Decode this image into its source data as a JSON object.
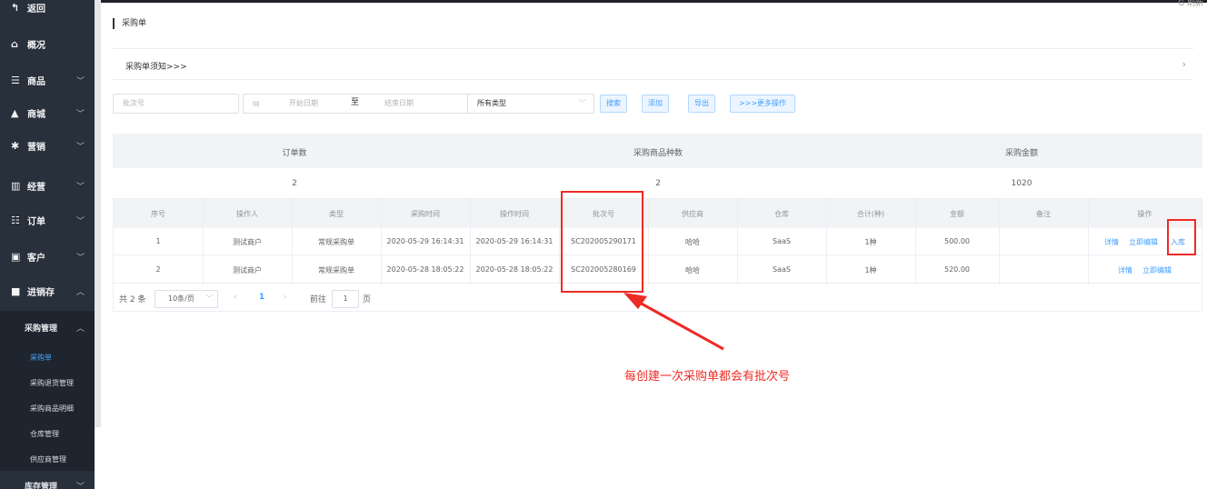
{
  "topbar": {
    "corner_text": "G 刷新"
  },
  "sidebar": {
    "items": [
      {
        "icon": "back-arrow-icon",
        "glyph": "↰",
        "label": "返回",
        "chevron": ""
      },
      {
        "icon": "home-icon",
        "glyph": "⌂",
        "label": "概况",
        "chevron": ""
      },
      {
        "icon": "list-icon",
        "glyph": "☰",
        "label": "商品",
        "chevron": "﹀"
      },
      {
        "icon": "shopping-bag-icon",
        "glyph": "▲",
        "label": "商城",
        "chevron": "﹀"
      },
      {
        "icon": "gift-icon",
        "glyph": "✱",
        "label": "营销",
        "chevron": "﹀"
      },
      {
        "icon": "bar-chart-icon",
        "glyph": "▥",
        "label": "经营",
        "chevron": "﹀"
      },
      {
        "icon": "order-list-icon",
        "glyph": "☷",
        "label": "订单",
        "chevron": "﹀"
      },
      {
        "icon": "contact-card-icon",
        "glyph": "▣",
        "label": "客户",
        "chevron": "﹀"
      },
      {
        "icon": "truck-icon",
        "glyph": "■",
        "label": "进销存",
        "chevron": "︿"
      }
    ],
    "submenu": {
      "label": "采购管理",
      "chevron": "︿"
    },
    "leaves": [
      {
        "label": "采购单",
        "active": true
      },
      {
        "label": "采购退货管理",
        "active": false
      },
      {
        "label": "采购商品明细",
        "active": false
      },
      {
        "label": "仓库管理",
        "active": false
      },
      {
        "label": "供应商管理",
        "active": false
      }
    ],
    "next_submenu": {
      "label": "库存管理",
      "chevron": "﹀"
    }
  },
  "page": {
    "title": "采购单",
    "notice": "采购单须知>>>",
    "notice_arrow": "›"
  },
  "filters": {
    "batch_placeholder": "批次号",
    "date_icon": "▤",
    "start_placeholder": "开始日期",
    "range_sep": "至",
    "end_placeholder": "结束日期",
    "type_value": "所有类型",
    "type_chevron": "﹀",
    "search_label": "搜索",
    "add_label": "添加",
    "export_label": "导出",
    "more_label": ">>>更多操作"
  },
  "summary": {
    "headers": [
      "订单数",
      "采购商品种数",
      "采购金额"
    ],
    "values": [
      "2",
      "2",
      "1020"
    ]
  },
  "table": {
    "columns": [
      "序号",
      "操作人",
      "类型",
      "采购时间",
      "操作时间",
      "批次号",
      "供应商",
      "仓库",
      "合计(种)",
      "金额",
      "备注",
      "操作"
    ],
    "rows": [
      {
        "cells": [
          "1",
          "测试商户",
          "常规采购单",
          "2020-05-29 16:14:31",
          "2020-05-29 16:14:31",
          "SC202005290171",
          "哈哈",
          "SaaS",
          "1种",
          "500.00",
          ""
        ],
        "actions": [
          "详情",
          "立即编辑",
          "入库"
        ]
      },
      {
        "cells": [
          "2",
          "测试商户",
          "常规采购单",
          "2020-05-28 18:05:22",
          "2020-05-28 18:05:22",
          "SC202005280169",
          "哈哈",
          "SaaS",
          "1种",
          "520.00",
          ""
        ],
        "actions": [
          "详情",
          "立即编辑"
        ]
      }
    ]
  },
  "pager": {
    "total": "共 2 条",
    "page_size": "10条/页",
    "size_chevron": "﹀",
    "prev": "‹",
    "current": "1",
    "next": "›",
    "goto_label": "前往",
    "goto_value": "1",
    "page_unit": "页"
  },
  "annotation": {
    "text": "每创建一次采购单都会有批次号",
    "color": "#ee2a24"
  }
}
